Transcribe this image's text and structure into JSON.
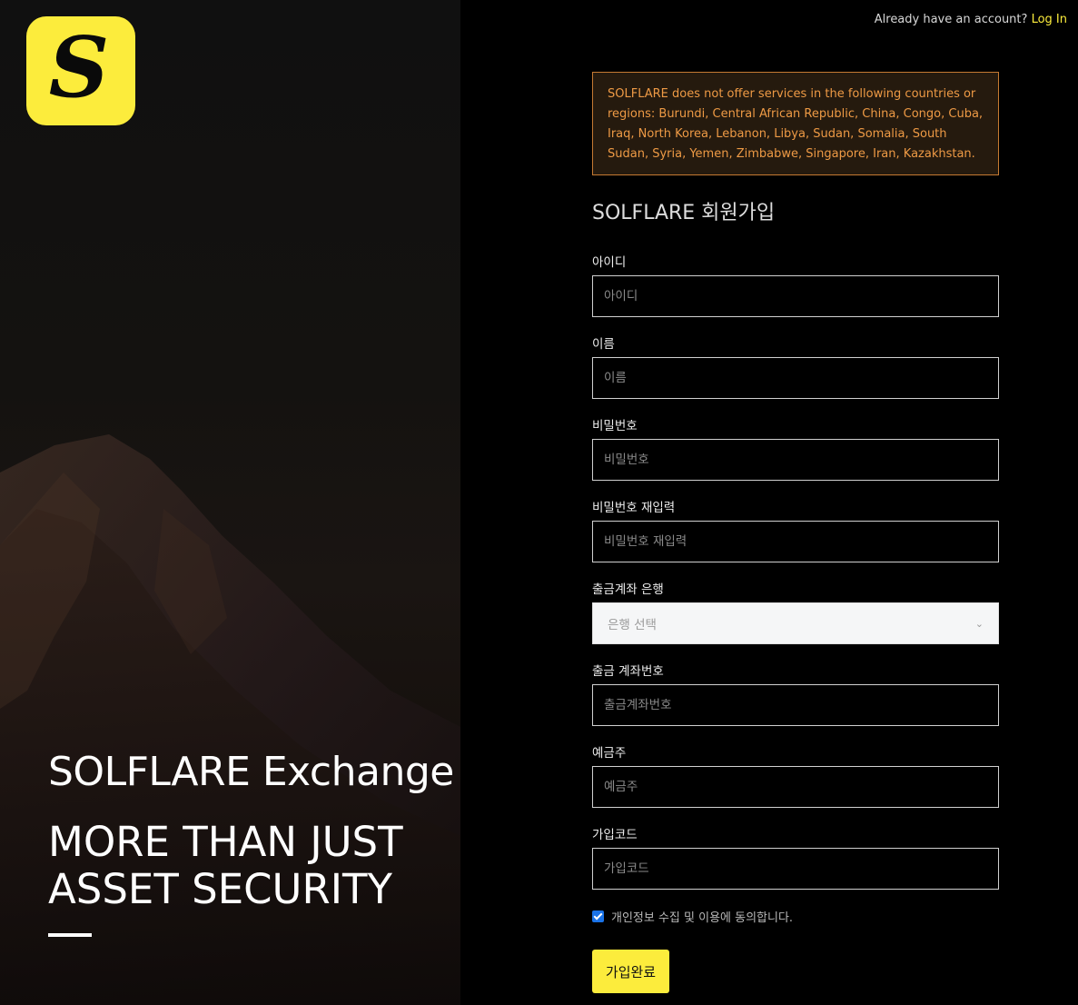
{
  "brand": {
    "logo_letter": "S",
    "accent_color": "#fcec3c",
    "logo_icon": "solflare-s-logo-icon"
  },
  "hero": {
    "title": "SOLFLARE Exchange",
    "tagline_line1": "MORE THAN JUST",
    "tagline_line2": "ASSET SECURITY"
  },
  "header": {
    "login_prompt": "Already have an account?",
    "login_link": "Log In"
  },
  "notice": {
    "text": "SOLFLARE does not offer services in the following countries or regions: Burundi, Central African Republic, China, Congo, Cuba, Iraq, North Korea, Lebanon, Libya, Sudan, Somalia, South Sudan, Syria, Yemen, Zimbabwe, Singapore, Iran, Kazakhstan."
  },
  "form": {
    "title": "SOLFLARE 회원가입",
    "fields": {
      "userid": {
        "label": "아이디",
        "placeholder": "아이디"
      },
      "name": {
        "label": "이름",
        "placeholder": "이름"
      },
      "password": {
        "label": "비밀번호",
        "placeholder": "비밀번호"
      },
      "password_confirm": {
        "label": "비밀번호 재입력",
        "placeholder": "비밀번호 재입력"
      },
      "bank": {
        "label": "출금계좌 은행",
        "selected": "은행 선택"
      },
      "account_number": {
        "label": "출금 계좌번호",
        "placeholder": "출금계좌번호"
      },
      "account_holder": {
        "label": "예금주",
        "placeholder": "예금주"
      },
      "signup_code": {
        "label": "가입코드",
        "placeholder": "가입코드"
      }
    },
    "agree_label": "개인정보 수집 및 이용에 동의합니다.",
    "agree_checked": true,
    "submit_label": "가입완료"
  }
}
